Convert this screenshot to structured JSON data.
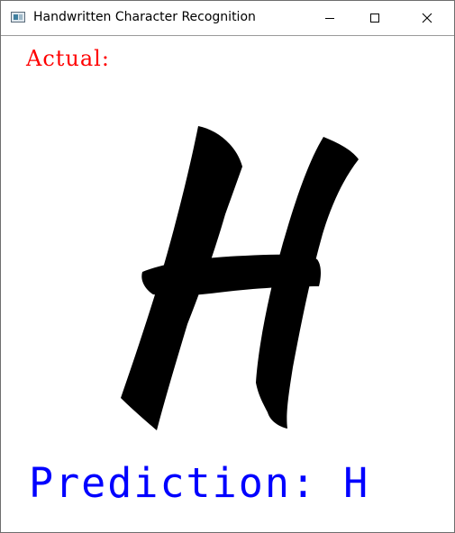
{
  "window": {
    "title": "Handwritten Character Recognition",
    "controls": {
      "minimize_icon": "minimize-icon",
      "maximize_icon": "maximize-icon",
      "close_icon": "close-icon"
    }
  },
  "canvas": {
    "actual_label": "Actual:",
    "character_image": "handwritten-H",
    "prediction_text": "Prediction: H"
  },
  "colors": {
    "actual_label": "#ff0000",
    "prediction_text": "#0000ff",
    "glyph": "#000000",
    "background": "#ffffff"
  }
}
